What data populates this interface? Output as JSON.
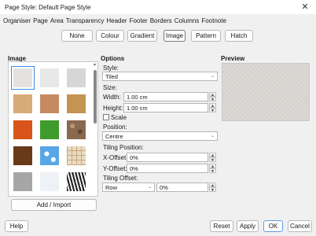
{
  "window": {
    "title": "Page Style: Default Page Style"
  },
  "tabs": [
    "Organiser",
    "Page",
    "Area",
    "Transparency",
    "Header",
    "Footer",
    "Borders",
    "Columns",
    "Footnote"
  ],
  "toolbar": [
    "None",
    "Colour",
    "Gradient",
    "Image",
    "Pattern",
    "Hatch"
  ],
  "image_section": {
    "label": "Image",
    "add_import": "Add / Import",
    "thumbnails": [
      {
        "name": "painted-white",
        "color": "#e4e2de"
      },
      {
        "name": "paper-texture",
        "color": "#e8e8e8"
      },
      {
        "name": "paper-crumpled",
        "color": "#d6d6d6"
      },
      {
        "name": "parchment-paper",
        "color": "#d9ab78"
      },
      {
        "name": "fence",
        "color": "#c58a62"
      },
      {
        "name": "wooden-board",
        "color": "#c49454"
      },
      {
        "name": "maple-leaves",
        "color": "#d8541a"
      },
      {
        "name": "lawn",
        "color": "#3f9b2b"
      },
      {
        "name": "colorful-pebbles",
        "color": "#8a6a4e"
      },
      {
        "name": "coffee-beans",
        "color": "#6a3a18"
      },
      {
        "name": "little-clouds",
        "color": "#59a6e6"
      },
      {
        "name": "bathroom-tiles",
        "color": "#d8c7a8"
      },
      {
        "name": "wall-of-rock",
        "color": "#a6a6a6"
      },
      {
        "name": "stone",
        "color": "#eef2f6"
      },
      {
        "name": "zebra",
        "color": "#2a2a2a"
      }
    ]
  },
  "options": {
    "label": "Options",
    "style_label": "Style:",
    "style_value": "Tiled",
    "size_label": "Size:",
    "width_label": "Width:",
    "width_value": "1.00 cm",
    "height_label": "Height:",
    "height_value": "1.00 cm",
    "scale_label": "Scale",
    "position_label": "Position:",
    "position_value": "Centre",
    "tiling_position_label": "Tiling Position:",
    "x_offset_label": "X-Offset:",
    "x_offset_value": "0%",
    "y_offset_label": "Y-Offset:",
    "y_offset_value": "0%",
    "tiling_offset_label": "Tiling Offset:",
    "tiling_offset_mode": "Row",
    "tiling_offset_value": "0%"
  },
  "preview": {
    "label": "Preview"
  },
  "buttons": {
    "help": "Help",
    "reset": "Reset",
    "apply": "Apply",
    "ok": "OK",
    "cancel": "Cancel"
  }
}
